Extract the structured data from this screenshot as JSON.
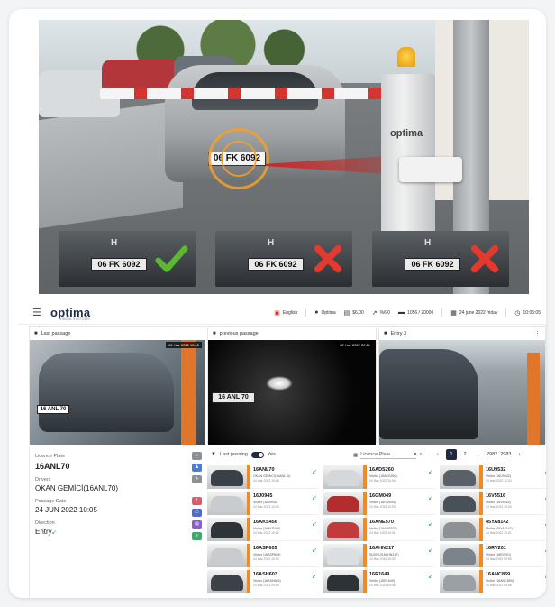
{
  "hero": {
    "main_plate": "06 FK 6092",
    "pole_logo": "optima",
    "thumbs": [
      {
        "plate": "06 FK 6092",
        "result": "match",
        "mark_color": "#5cb82e"
      },
      {
        "plate": "06 FK 6092",
        "result": "mismatch",
        "mark_color": "#e23a2e"
      },
      {
        "plate": "06 FK 6092",
        "result": "mismatch",
        "mark_color": "#e23a2e"
      }
    ]
  },
  "topbar": {
    "brand": "optima",
    "brand_sub": "VISION SYSTEMS",
    "language": "English",
    "user": "Optima",
    "plan": "$6,00",
    "stat": "%6,0",
    "counter": "1056 / 20000",
    "date": "24 june 2022 friday",
    "time": "10:05:05"
  },
  "cameras": [
    {
      "title": "Last passage",
      "icon": "camera-icon",
      "stamp": "24 Haz 2022 10:05",
      "plate": "16 ANL 70"
    },
    {
      "title": "previous passage",
      "icon": "camera-icon",
      "stamp": "22 Haz 2022 22:21",
      "plate": "16 ANL 70"
    },
    {
      "title": "Entry 3",
      "icon": "camera-icon",
      "stamp": "",
      "plate": ""
    }
  ],
  "info": {
    "plate_label": "Licence Plate",
    "plate_value": "16ANL70",
    "drivers_label": "Drivers",
    "drivers_value": "OKAN GEMİCİ(16ANL70)",
    "date_label": "Passage Date",
    "date_value": "24 JUN 2022 10:05",
    "direction_label": "Direction",
    "direction_value": "Entry",
    "side_buttons": [
      {
        "icon": "search-icon",
        "color": "#8b8f96"
      },
      {
        "icon": "people-icon",
        "color": "#4d7bd8"
      },
      {
        "icon": "edit-icon",
        "color": "#8b8f96"
      },
      {
        "icon": "alert-icon",
        "color": "#e05a6a"
      },
      {
        "icon": "card-icon",
        "color": "#4f6bd0"
      },
      {
        "icon": "doc-icon",
        "color": "#8a5ad8"
      },
      {
        "icon": "list-icon",
        "color": "#3cab6c"
      }
    ]
  },
  "passings": {
    "toggle_label": "Last passing",
    "toggle_state": "Yes",
    "filter_placeholder": "Licence Plate",
    "pager": [
      "‹",
      "1",
      "2",
      "...",
      "2982",
      "2983",
      "›"
    ],
    "rows": [
      {
        "plate": "16ANL70",
        "sub": "OKAN GEMİCİ(16ANL70)",
        "date": "24 Haz 2022 10:05"
      },
      {
        "plate": "16ADS260",
        "sub": "Visitor (16ADS260)",
        "date": "24 Haz 2022 10:04"
      },
      {
        "plate": "16U9532",
        "sub": "Visitor (16U9532)",
        "date": "24 Haz 2022 10:03"
      },
      {
        "plate": "16J0945",
        "sub": "Visitor (16J0945)",
        "date": "24 Haz 2022 10:03"
      },
      {
        "plate": "16GM049",
        "sub": "Visitor (16GM049)",
        "date": "24 Haz 2022 10:03"
      },
      {
        "plate": "16V5516",
        "sub": "Visitor (16V5516)",
        "date": "24 Haz 2022 10:03"
      },
      {
        "plate": "16AKS456",
        "sub": "Visitor (16AKS456)",
        "date": "24 Haz 2022 10:02"
      },
      {
        "plate": "16ANE570",
        "sub": "Visitor (16ANE570)",
        "date": "24 Haz 2022 10:01"
      },
      {
        "plate": "45YA8142",
        "sub": "Visitor (45YA8142)",
        "date": "24 Haz 2022 10:01"
      },
      {
        "plate": "16ASP605",
        "sub": "Visitor (16ASP605)",
        "date": "24 Haz 2022 10:00"
      },
      {
        "plate": "16AHN217",
        "sub": "ŞÜKRÜ(16AHN217)",
        "date": "24 Haz 2022 10:00"
      },
      {
        "plate": "16RV201",
        "sub": "Visitor (16RV201)",
        "date": "24 Haz 2022 09:59"
      },
      {
        "plate": "16ASH603",
        "sub": "Visitor (16ASH603)",
        "date": "24 Haz 2022 09:59"
      },
      {
        "plate": "16R1649",
        "sub": "Visitor (16R1649)",
        "date": "24 Haz 2022 09:58"
      },
      {
        "plate": "16ANC859",
        "sub": "Visitor (16ANC859)",
        "date": "24 Haz 2022 09:58"
      }
    ]
  }
}
